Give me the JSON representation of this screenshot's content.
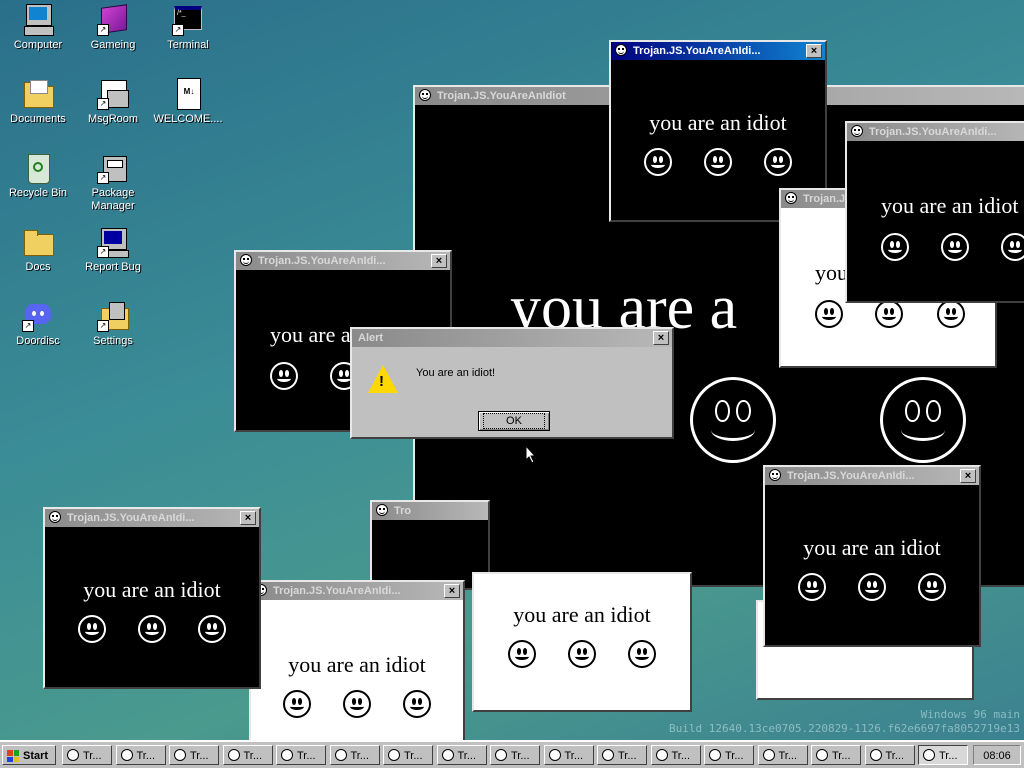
{
  "desktop": {
    "icons": [
      {
        "label": "Computer",
        "icon": "computer-icon"
      },
      {
        "label": "Gameing",
        "icon": "game-cube-icon"
      },
      {
        "label": "Terminal",
        "icon": "terminal-icon"
      },
      {
        "label": "Documents",
        "icon": "documents-folder-icon"
      },
      {
        "label": "MsgRoom",
        "icon": "msgroom-icon"
      },
      {
        "label": "WELCOME....",
        "icon": "markdown-file-icon"
      },
      {
        "label": "Recycle Bin",
        "icon": "recycle-bin-icon"
      },
      {
        "label": "Package Manager",
        "icon": "package-manager-icon"
      },
      {
        "label": "Docs",
        "icon": "docs-folder-icon"
      },
      {
        "label": "Report Bug",
        "icon": "report-bug-icon"
      },
      {
        "label": "Doordisc",
        "icon": "doordisc-icon"
      },
      {
        "label": "Settings",
        "icon": "settings-icon"
      }
    ]
  },
  "popup": {
    "title_full": "Trojan.JS.YouAreAnIdiot",
    "title_short": "Trojan.JS.YouAreAnIdi...",
    "title_tiny": "Tro",
    "message": "you are an idiot",
    "message_partial": "you are a",
    "message_partial2": "you are a",
    "message_partial3": "you",
    "close_label": "×"
  },
  "alert": {
    "title": "Alert",
    "message": "You are an idiot!",
    "ok_label": "OK",
    "close_label": "×"
  },
  "taskbar": {
    "start_label": "Start",
    "task_label": "Tr...",
    "task_count": 17,
    "clock": "08:06"
  },
  "watermark": {
    "line1": "Windows 96 main",
    "line2": "Build 12640.13ce0705.220829-1126.f62e6697fa8052719e13"
  },
  "colors": {
    "desktop_bg": "#3a8c96",
    "window_face": "#c0c0c0",
    "active_title": "#000080",
    "inactive_title": "#8a8a8a"
  }
}
